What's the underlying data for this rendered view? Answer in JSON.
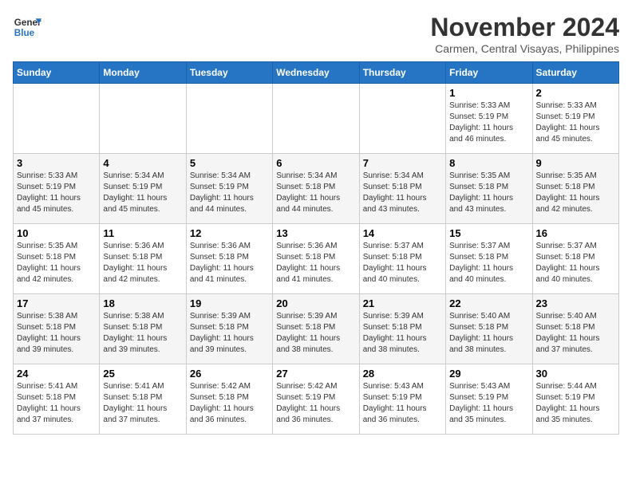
{
  "header": {
    "logo_line1": "General",
    "logo_line2": "Blue",
    "month": "November 2024",
    "location": "Carmen, Central Visayas, Philippines"
  },
  "weekdays": [
    "Sunday",
    "Monday",
    "Tuesday",
    "Wednesday",
    "Thursday",
    "Friday",
    "Saturday"
  ],
  "weeks": [
    [
      {
        "day": "",
        "info": ""
      },
      {
        "day": "",
        "info": ""
      },
      {
        "day": "",
        "info": ""
      },
      {
        "day": "",
        "info": ""
      },
      {
        "day": "",
        "info": ""
      },
      {
        "day": "1",
        "info": "Sunrise: 5:33 AM\nSunset: 5:19 PM\nDaylight: 11 hours\nand 46 minutes."
      },
      {
        "day": "2",
        "info": "Sunrise: 5:33 AM\nSunset: 5:19 PM\nDaylight: 11 hours\nand 45 minutes."
      }
    ],
    [
      {
        "day": "3",
        "info": "Sunrise: 5:33 AM\nSunset: 5:19 PM\nDaylight: 11 hours\nand 45 minutes."
      },
      {
        "day": "4",
        "info": "Sunrise: 5:34 AM\nSunset: 5:19 PM\nDaylight: 11 hours\nand 45 minutes."
      },
      {
        "day": "5",
        "info": "Sunrise: 5:34 AM\nSunset: 5:19 PM\nDaylight: 11 hours\nand 44 minutes."
      },
      {
        "day": "6",
        "info": "Sunrise: 5:34 AM\nSunset: 5:18 PM\nDaylight: 11 hours\nand 44 minutes."
      },
      {
        "day": "7",
        "info": "Sunrise: 5:34 AM\nSunset: 5:18 PM\nDaylight: 11 hours\nand 43 minutes."
      },
      {
        "day": "8",
        "info": "Sunrise: 5:35 AM\nSunset: 5:18 PM\nDaylight: 11 hours\nand 43 minutes."
      },
      {
        "day": "9",
        "info": "Sunrise: 5:35 AM\nSunset: 5:18 PM\nDaylight: 11 hours\nand 42 minutes."
      }
    ],
    [
      {
        "day": "10",
        "info": "Sunrise: 5:35 AM\nSunset: 5:18 PM\nDaylight: 11 hours\nand 42 minutes."
      },
      {
        "day": "11",
        "info": "Sunrise: 5:36 AM\nSunset: 5:18 PM\nDaylight: 11 hours\nand 42 minutes."
      },
      {
        "day": "12",
        "info": "Sunrise: 5:36 AM\nSunset: 5:18 PM\nDaylight: 11 hours\nand 41 minutes."
      },
      {
        "day": "13",
        "info": "Sunrise: 5:36 AM\nSunset: 5:18 PM\nDaylight: 11 hours\nand 41 minutes."
      },
      {
        "day": "14",
        "info": "Sunrise: 5:37 AM\nSunset: 5:18 PM\nDaylight: 11 hours\nand 40 minutes."
      },
      {
        "day": "15",
        "info": "Sunrise: 5:37 AM\nSunset: 5:18 PM\nDaylight: 11 hours\nand 40 minutes."
      },
      {
        "day": "16",
        "info": "Sunrise: 5:37 AM\nSunset: 5:18 PM\nDaylight: 11 hours\nand 40 minutes."
      }
    ],
    [
      {
        "day": "17",
        "info": "Sunrise: 5:38 AM\nSunset: 5:18 PM\nDaylight: 11 hours\nand 39 minutes."
      },
      {
        "day": "18",
        "info": "Sunrise: 5:38 AM\nSunset: 5:18 PM\nDaylight: 11 hours\nand 39 minutes."
      },
      {
        "day": "19",
        "info": "Sunrise: 5:39 AM\nSunset: 5:18 PM\nDaylight: 11 hours\nand 39 minutes."
      },
      {
        "day": "20",
        "info": "Sunrise: 5:39 AM\nSunset: 5:18 PM\nDaylight: 11 hours\nand 38 minutes."
      },
      {
        "day": "21",
        "info": "Sunrise: 5:39 AM\nSunset: 5:18 PM\nDaylight: 11 hours\nand 38 minutes."
      },
      {
        "day": "22",
        "info": "Sunrise: 5:40 AM\nSunset: 5:18 PM\nDaylight: 11 hours\nand 38 minutes."
      },
      {
        "day": "23",
        "info": "Sunrise: 5:40 AM\nSunset: 5:18 PM\nDaylight: 11 hours\nand 37 minutes."
      }
    ],
    [
      {
        "day": "24",
        "info": "Sunrise: 5:41 AM\nSunset: 5:18 PM\nDaylight: 11 hours\nand 37 minutes."
      },
      {
        "day": "25",
        "info": "Sunrise: 5:41 AM\nSunset: 5:18 PM\nDaylight: 11 hours\nand 37 minutes."
      },
      {
        "day": "26",
        "info": "Sunrise: 5:42 AM\nSunset: 5:18 PM\nDaylight: 11 hours\nand 36 minutes."
      },
      {
        "day": "27",
        "info": "Sunrise: 5:42 AM\nSunset: 5:19 PM\nDaylight: 11 hours\nand 36 minutes."
      },
      {
        "day": "28",
        "info": "Sunrise: 5:43 AM\nSunset: 5:19 PM\nDaylight: 11 hours\nand 36 minutes."
      },
      {
        "day": "29",
        "info": "Sunrise: 5:43 AM\nSunset: 5:19 PM\nDaylight: 11 hours\nand 35 minutes."
      },
      {
        "day": "30",
        "info": "Sunrise: 5:44 AM\nSunset: 5:19 PM\nDaylight: 11 hours\nand 35 minutes."
      }
    ]
  ]
}
